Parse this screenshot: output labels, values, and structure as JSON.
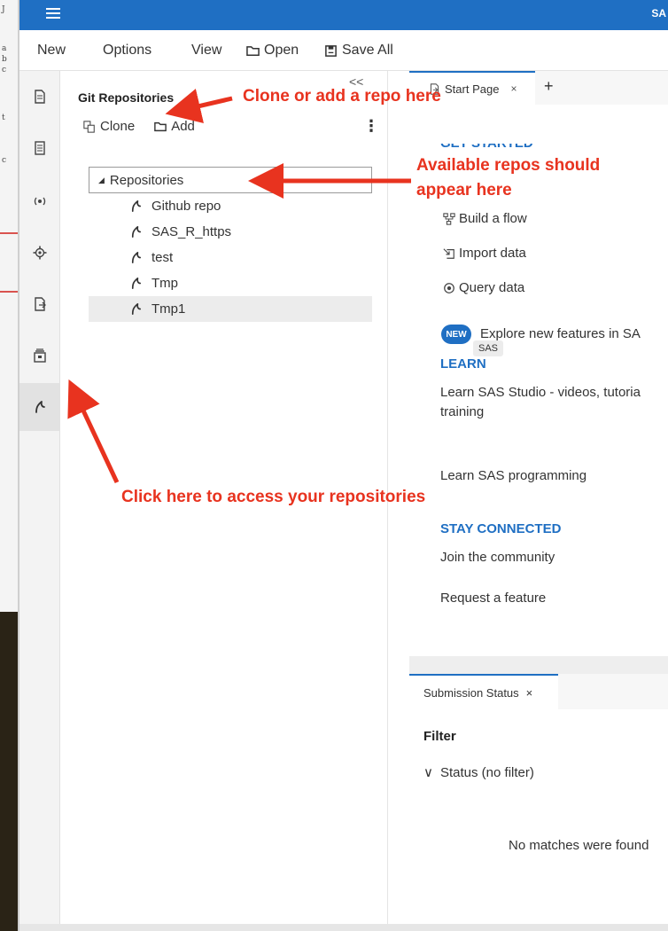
{
  "titlebar": {
    "brand": "SA"
  },
  "menubar": {
    "new": "New",
    "options": "Options",
    "view": "View",
    "open": "Open",
    "save_all": "Save All"
  },
  "activitybar": {
    "items": [
      "file-icon",
      "document-icon",
      "signal-icon",
      "gear-icon",
      "export-icon",
      "libraries-icon",
      "git-branch-icon"
    ]
  },
  "git_pane": {
    "collapse": "<<",
    "title": "Git Repositories",
    "clone": "Clone",
    "add": "Add",
    "more": "⋮",
    "tree_root": "Repositories",
    "repos": [
      "Github repo",
      "SAS_R_https",
      "test",
      "Tmp",
      "Tmp1"
    ],
    "selected_repo": "Tmp1"
  },
  "editor": {
    "tab_label": "Start Page",
    "tab_close": "×",
    "tab_add": "+"
  },
  "start_page": {
    "get_started": "GET STARTED",
    "build_flow": "Build a flow",
    "import_data": "Import data",
    "query_data": "Query data",
    "new_badge": "NEW",
    "explore": "Explore new features in SA",
    "tooltip": "SAS",
    "learn_head": "LEARN",
    "learn_studio_line1": "Learn SAS Studio - videos, tutoria",
    "learn_studio_line2": "training",
    "learn_programming": "Learn SAS programming",
    "stay_connected": "STAY CONNECTED",
    "join_community": "Join the community",
    "request_feature": "Request a feature"
  },
  "submission": {
    "tab_label": "Submission Status",
    "tab_close": "×",
    "filter_head": "Filter",
    "status_chevron": "∨",
    "status_filter": "Status (no filter)",
    "no_matches": "No matches were found"
  },
  "annotations": {
    "clone_add": "Clone or add a repo here",
    "available_line1": "Available repos should",
    "available_line2": "appear here",
    "click_here": "Click here to access your repositories",
    "color": "#e8331f"
  }
}
